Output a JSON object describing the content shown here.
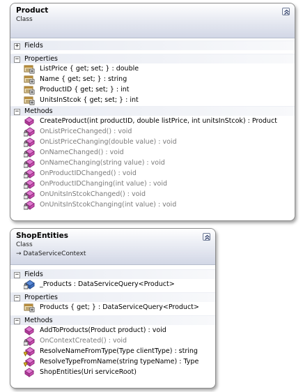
{
  "product": {
    "title": "Product",
    "kind": "Class",
    "sections": {
      "fields": "Fields",
      "properties": "Properties",
      "methods": "Methods"
    },
    "properties": [
      "ListPrice { get; set; } : double",
      "Name { get; set; } : string",
      "ProductID { get; set; } : int",
      "UnitsInStcok { get; set; } : int"
    ],
    "methods": [
      {
        "text": "CreateProduct(int productID, double listPrice, int unitsInStcok) : Product",
        "icon": "public-method-icon",
        "muted": false
      },
      {
        "text": "OnListPriceChanged() : void",
        "icon": "private-method-icon",
        "muted": true
      },
      {
        "text": "OnListPriceChanging(double value) : void",
        "icon": "private-method-icon",
        "muted": true
      },
      {
        "text": "OnNameChanged() : void",
        "icon": "private-method-icon",
        "muted": true
      },
      {
        "text": "OnNameChanging(string value) : void",
        "icon": "private-method-icon",
        "muted": true
      },
      {
        "text": "OnProductIDChanged() : void",
        "icon": "private-method-icon",
        "muted": true
      },
      {
        "text": "OnProductIDChanging(int value) : void",
        "icon": "private-method-icon",
        "muted": true
      },
      {
        "text": "OnUnitsInStcokChanged() : void",
        "icon": "private-method-icon",
        "muted": true
      },
      {
        "text": "OnUnitsInStcokChanging(int value) : void",
        "icon": "private-method-icon",
        "muted": true
      }
    ]
  },
  "shop": {
    "title": "ShopEntities",
    "kind": "Class",
    "base": "→ DataServiceContext",
    "sections": {
      "fields": "Fields",
      "properties": "Properties",
      "methods": "Methods"
    },
    "fields": [
      "_Products : DataServiceQuery<Product>"
    ],
    "properties": [
      "Products { get; } : DataServiceQuery<Product>"
    ],
    "methods": [
      {
        "text": "AddToProducts(Product product) : void",
        "icon": "public-method-icon",
        "muted": false
      },
      {
        "text": "OnContextCreated() : void",
        "icon": "private-method-icon",
        "muted": true
      },
      {
        "text": "ResolveNameFromType(Type clientType) : string",
        "icon": "protected-method-icon",
        "muted": false
      },
      {
        "text": "ResolveTypeFromName(string typeName) : Type",
        "icon": "protected-method-icon",
        "muted": false
      },
      {
        "text": "ShopEntities(Uri serviceRoot)",
        "icon": "public-method-icon",
        "muted": false
      }
    ]
  },
  "colors": {
    "method_pink": "#c23ea8",
    "property_brown": "#8a6a2a",
    "field_blue": "#3a68b8",
    "muted_text": "#7a7a7a"
  }
}
